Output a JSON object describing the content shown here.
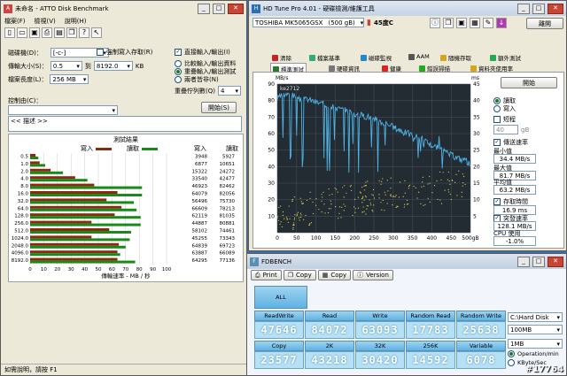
{
  "atto": {
    "title": "未命名 - ATTO Disk Benchmark",
    "menu": [
      "檔案(F)",
      "檢視(V)",
      "說明(H)"
    ],
    "drive_label": "磁碟機(D)：",
    "drive_value": "[-c-]",
    "force_write_label": "強制寫入存取(R)",
    "direct_io_label": "直接輸入/輸出(I)",
    "transfer_size_label": "傳輸大小(S)：",
    "transfer_from": "0.5",
    "transfer_to_label": "到",
    "transfer_to": "8192.0",
    "transfer_unit": "KB",
    "overlap_io_label": "比較輸入/輸出資料",
    "total_length_label": "檔案長度(L)：",
    "total_length": "256 MB",
    "overlapped_label": "重疊輸入/輸出測試",
    "neither_label": "兩者皆非(N)",
    "queue_depth_label": "重疊佇列數(Q)",
    "queue_depth": "4",
    "controlled_label": "控制由(C)：",
    "controlled_value": "",
    "start_button": "開始(S)",
    "description_text": "<<  描述  >>",
    "results_title": "測試結果",
    "legend_write": "寫入",
    "legend_read": "讀取",
    "col_write": "寫入",
    "col_read": "讀取",
    "xaxis_title": "傳輸速率 - MB / 秒",
    "xticks": [
      "0",
      "10",
      "20",
      "30",
      "40",
      "50",
      "60",
      "70",
      "80",
      "90",
      "100"
    ],
    "status": "如需說明，請按 F1"
  },
  "chart_data": [
    {
      "type": "bar",
      "title": "測試結果",
      "xlabel": "傳輸速率 - MB / 秒",
      "xlim": [
        0,
        100
      ],
      "categories": [
        "0.5",
        "1.0",
        "2.0",
        "4.0",
        "8.0",
        "16.0",
        "32.0",
        "64.0",
        "128.0",
        "256.0",
        "512.0",
        "1024.0",
        "2048.0",
        "4096.0",
        "8192.0"
      ],
      "series": [
        {
          "name": "寫入",
          "values": [
            3948,
            6877,
            15322,
            33540,
            46923,
            64079,
            56496,
            66609,
            62119,
            44887,
            58102,
            45255,
            64839,
            63887,
            64295
          ]
        },
        {
          "name": "讀取",
          "values": [
            5927,
            10651,
            24272,
            42477,
            82462,
            82056,
            75730,
            78213,
            81035,
            80881,
            74461,
            73343,
            69723,
            66089,
            77136
          ]
        }
      ],
      "bar_percent": {
        "write": [
          4,
          7,
          15,
          33,
          47,
          64,
          56,
          67,
          62,
          45,
          58,
          45,
          65,
          64,
          64
        ],
        "read": [
          6,
          11,
          24,
          42,
          82,
          82,
          76,
          78,
          81,
          81,
          74,
          73,
          70,
          66,
          77
        ]
      }
    },
    {
      "type": "line",
      "title": "HD Tune Transfer Rate",
      "ylabel": "MB/s",
      "ylim": [
        0,
        90
      ],
      "y2label": "ms",
      "y2lim": [
        0,
        45
      ],
      "xlabel": "",
      "x_ticks": [
        "0",
        "50",
        "100",
        "150",
        "200",
        "250",
        "300",
        "350",
        "400",
        "450",
        "500gB"
      ],
      "xlim": [
        0,
        500
      ],
      "series": [
        {
          "name": "transfer_rate",
          "x": [
            0,
            20,
            40,
            60,
            80,
            100,
            120,
            140,
            160,
            180,
            200,
            220,
            240,
            260,
            280,
            300,
            320,
            340,
            360,
            380,
            400,
            420,
            440,
            460,
            480,
            500
          ],
          "y": [
            81,
            84,
            83,
            80,
            81,
            79,
            78,
            77,
            75,
            74,
            72,
            71,
            70,
            68,
            66,
            64,
            62,
            60,
            58,
            56,
            53,
            51,
            48,
            46,
            44,
            42
          ]
        },
        {
          "name": "access_time",
          "x": [
            0,
            50,
            100,
            150,
            200,
            250,
            300,
            350,
            400,
            450,
            500
          ],
          "y": [
            5,
            6,
            8,
            9,
            10,
            11,
            12,
            12,
            13,
            14,
            14
          ]
        }
      ]
    }
  ],
  "hdtune": {
    "title": "HD Tune Pro 4.01 - 硬碟檢測/維護工具",
    "drive": "TOSHIBA MK5065GSX",
    "drive_size": "(500 gB)",
    "temperature": "45度C",
    "exit_label": "離開",
    "tabs_row1": [
      "清除",
      "檔案基準",
      "磁碟監視",
      "AAM",
      "隨機存取",
      "額外測試"
    ],
    "tabs_row2": [
      "標準測試",
      "硬碟資訊",
      "健康",
      "錯誤掃描",
      "資料夾使用率"
    ],
    "chart_corner": "ke2712",
    "y_unit_left": "MB/s",
    "y_unit_right": "ms",
    "y_left_ticks": [
      "90",
      "80",
      "70",
      "60",
      "50",
      "40",
      "30",
      "20",
      "10"
    ],
    "y_right_ticks": [
      "45",
      "40",
      "35",
      "30",
      "25",
      "20",
      "15",
      "10",
      "5"
    ],
    "x_ticks": [
      "0",
      "50",
      "100",
      "150",
      "200",
      "250",
      "300",
      "350",
      "400",
      "450",
      "500gB"
    ],
    "start_button": "開始",
    "read_label": "讀取",
    "write_label": "寫入",
    "short_label": "短程",
    "short_value": "40",
    "short_unit": "gB",
    "transfer_rate_label": "傳送速率",
    "min_label": "最小值",
    "min_value": "34.4 MB/s",
    "max_label": "最大值",
    "max_value": "81.7 MB/s",
    "avg_label": "平均值",
    "avg_value": "63.2 MB/s",
    "access_time_label": "存取時間",
    "access_time_value": "16.9 ms",
    "burst_label": "突發速率",
    "burst_value": "128.1 MB/s",
    "cpu_label": "CPU 使用",
    "cpu_value": "-1.0%"
  },
  "fdbench": {
    "title": "FDBENCH",
    "toolbar": [
      "Print",
      "Copy",
      "Copy",
      "Version"
    ],
    "all_label": "ALL",
    "row1_labels": [
      "ReadWrite",
      "Read",
      "Write",
      "Random Read",
      "Random Write"
    ],
    "row1_values": [
      "47646",
      "84072",
      "63093",
      "17783",
      "25638"
    ],
    "row2_labels": [
      "Copy",
      "2K",
      "32K",
      "256K",
      "Variable"
    ],
    "row2_values": [
      "23577",
      "43218",
      "30420",
      "14592",
      "6078"
    ],
    "drive_select": "C:\\Hard Disk",
    "size_select": "100MB",
    "block_select": "1MB",
    "radio_operation": "Operation/min",
    "radio_kbyte": "KByte/Sec"
  },
  "watermark": "#17764",
  "colors": {
    "write": "#8c2a10",
    "read": "#178a17",
    "hd_line": "#4fb3e8",
    "hd_dots": "#e6d84a",
    "hd_bg": "#232b33"
  }
}
